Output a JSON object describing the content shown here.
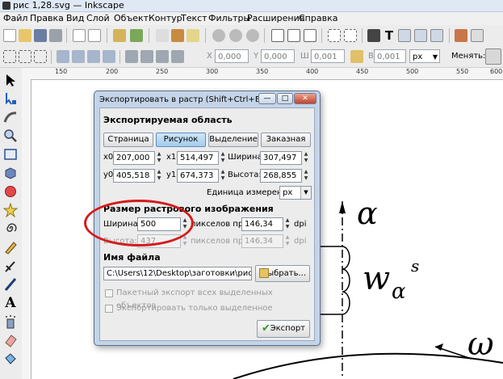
{
  "window": {
    "title": "рис 1,28.svg — Inkscape"
  },
  "menu": [
    "Файл",
    "Правка",
    "Вид",
    "Слой",
    "Объект",
    "Контур",
    "Текст",
    "Фильтры",
    "Расширения",
    "Справка"
  ],
  "controls": {
    "x_label": "X",
    "x_value": "0,000",
    "y_label": "Y",
    "y_value": "0,000",
    "w_label": "Ш",
    "w_value": "0,001",
    "h_label": "В",
    "h_value": "0,001",
    "unit": "px",
    "transform_label": "Менять:"
  },
  "ruler": {
    "ticks": [
      "150",
      "200",
      "250",
      "300",
      "350",
      "400",
      "450",
      "500",
      "550",
      "600"
    ]
  },
  "dialog": {
    "title": "Экспортировать в растр (Shift+Ctrl+E)",
    "export_area_title": "Экспортируемая область",
    "area_buttons": [
      "Страница",
      "Рисунок",
      "Выделение",
      "Заказная"
    ],
    "active_area": "Рисунок",
    "x0_label": "x0",
    "x0_value": "207,000",
    "x1_label": "x1",
    "x1_value": "514,497",
    "width_label": "Ширина:",
    "width_value": "307,497",
    "y0_label": "y0",
    "y0_value": "405,518",
    "y1_label": "y1",
    "y1_value": "674,373",
    "height_label": "Высота:",
    "height_value": "268,855",
    "units_label": "Единица измерения:",
    "units_value": "px",
    "bitmap_size_title": "Размер растрового изображения",
    "bmp_width_label": "Ширина:",
    "bmp_width_value": "500",
    "bmp_height_label": "Высота:",
    "bmp_height_value": "437",
    "pixels_at": "пикселов при",
    "dpi_value": "146,34",
    "dpi_value2": "146,34",
    "dpi": "dpi",
    "filename_title": "Имя файла",
    "filename_value": "C:\\Users\\12\\Desktop\\заготовки\\рис 1.28.\\",
    "browse_label": "Выбрать...",
    "batch_export_label": "Пакетный экспорт всех выделенных объектов",
    "export_selected_label": "Экспортировать только выделенное",
    "export_button": "Экспорт"
  },
  "drawing": {
    "alpha": "α",
    "w": "w",
    "w_sub": "α",
    "w_sup": "s",
    "omega": "ω"
  },
  "colors": {
    "highlight_ellipse": "#d61a1a",
    "dialog_frame": "#c4d4e8",
    "active_button": "#a4cbec"
  }
}
